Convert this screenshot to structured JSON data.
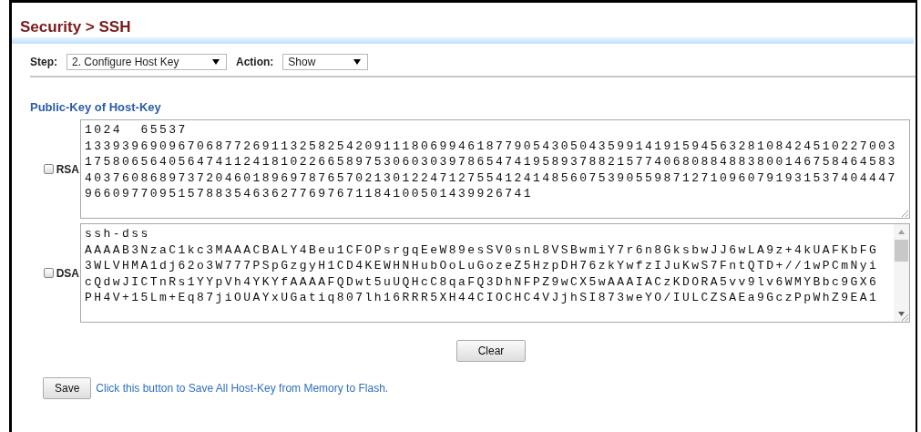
{
  "title": "Security > SSH",
  "step": {
    "label": "Step:",
    "value": "2. Configure Host Key"
  },
  "action": {
    "label": "Action:",
    "value": "Show"
  },
  "section_title": "Public-Key of Host-Key",
  "keys": [
    {
      "label": "RSA",
      "checked": false,
      "kind": "plain",
      "lines": [
        "1024  65537",
        "133939690967068772691132582542091118069946187790543050435991419159456328108424510227003",
        "175806564056474112418102266589753060303978654741958937882157740680884883800146758464583",
        "403760868973720460189697876570213012247127554124148560753905598712710960791931537404447",
        "966097709515788354636277697671184100501439926741"
      ]
    },
    {
      "label": "DSA",
      "checked": false,
      "kind": "scrolling",
      "lines": [
        "ssh-dss",
        "AAAAB3NzaC1kc3MAAACBALY4Beu1CFOPsrgqEeW89esSV0snL8VSBwmiY7r6n8GksbwJJ6wLA9z+4kUAFKbFG",
        "3WLVHMA1dj62o3W777PSpGzgyH1CD4KEWHNHubOoLuGozeZ5HzpDH76zkYwfzIJuKwS7FntQTD+//1wPCmNyi",
        "cQdwJICTnRs1YYpVh4YKYfAAAAFQDwt5uUQHcC8qaFQ3DhNFPZ9wCX5wAAAIACzKDORA5vv9lv6WMYBbc9GX6",
        "PH4V+15Lm+Eq87jiOUAYxUGatiq807lh16RRR5XH44CIOCHC4VJjhSI873weYO/IULCZSAEa9GczPpWhZ9EA1"
      ]
    }
  ],
  "clear_button": "Clear",
  "save_button": "Save",
  "save_hint": "Click this button to Save All Host-Key from Memory to Flash."
}
